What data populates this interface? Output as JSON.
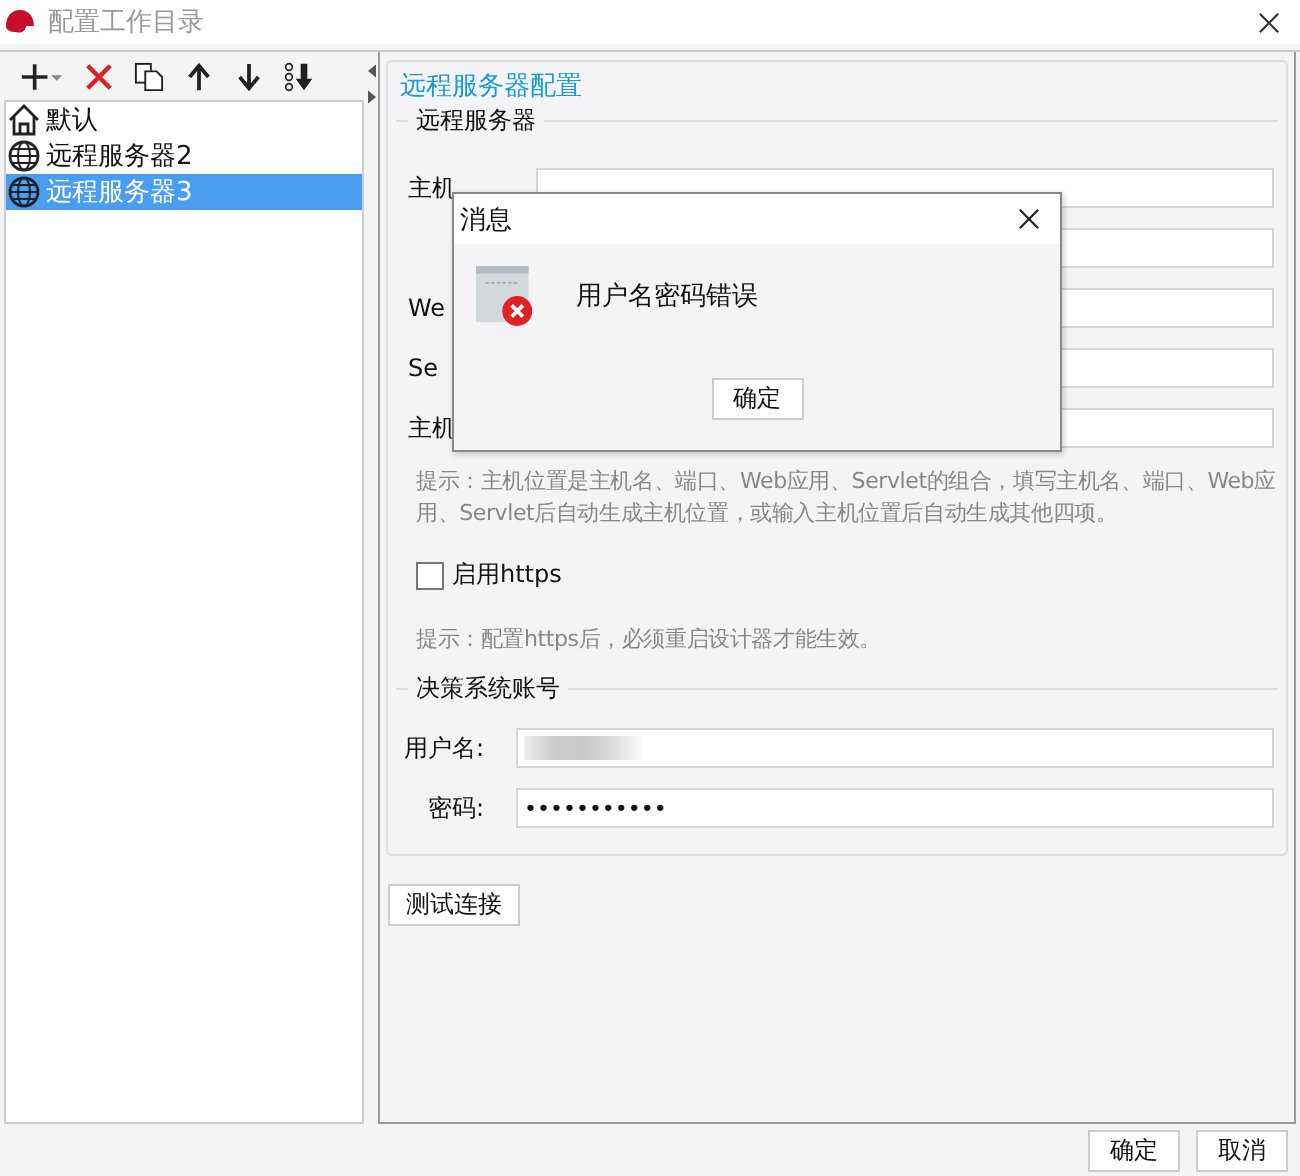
{
  "window": {
    "title": "配置工作目录"
  },
  "tree": [
    {
      "label": "默认",
      "kind": "home",
      "selected": false
    },
    {
      "label": "远程服务器2",
      "kind": "globe",
      "selected": false
    },
    {
      "label": "远程服务器3",
      "kind": "globe",
      "selected": true
    }
  ],
  "panel": {
    "title": "远程服务器配置",
    "server_group": "远程服务器",
    "fields": [
      {
        "kind": "labeled",
        "label": "主机"
      },
      {
        "kind": "plain"
      },
      {
        "kind": "labeled",
        "label": "We"
      },
      {
        "kind": "labeled",
        "label": "Se"
      },
      {
        "kind": "labeled",
        "label": "主机"
      }
    ],
    "hint": "提示：主机位置是主机名、端口、Web应用、Servlet的组合，填写主机名、端口、Web应用、Servlet后自动生成主机位置，或输入主机位置后自动生成其他四项。",
    "https": {
      "label": "启用https",
      "checked": false
    },
    "hint2": "提示：配置https后，必须重启设计器才能生效。",
    "account_group": "决策系统账号",
    "username_label": "用户名:",
    "password_label": "密码:",
    "password": "•••••••••••",
    "test_button": "测试连接"
  },
  "buttons": [
    "确定",
    "取消"
  ],
  "dialog": {
    "title": "消息",
    "message": "用户名密码错误",
    "button": "确定"
  }
}
